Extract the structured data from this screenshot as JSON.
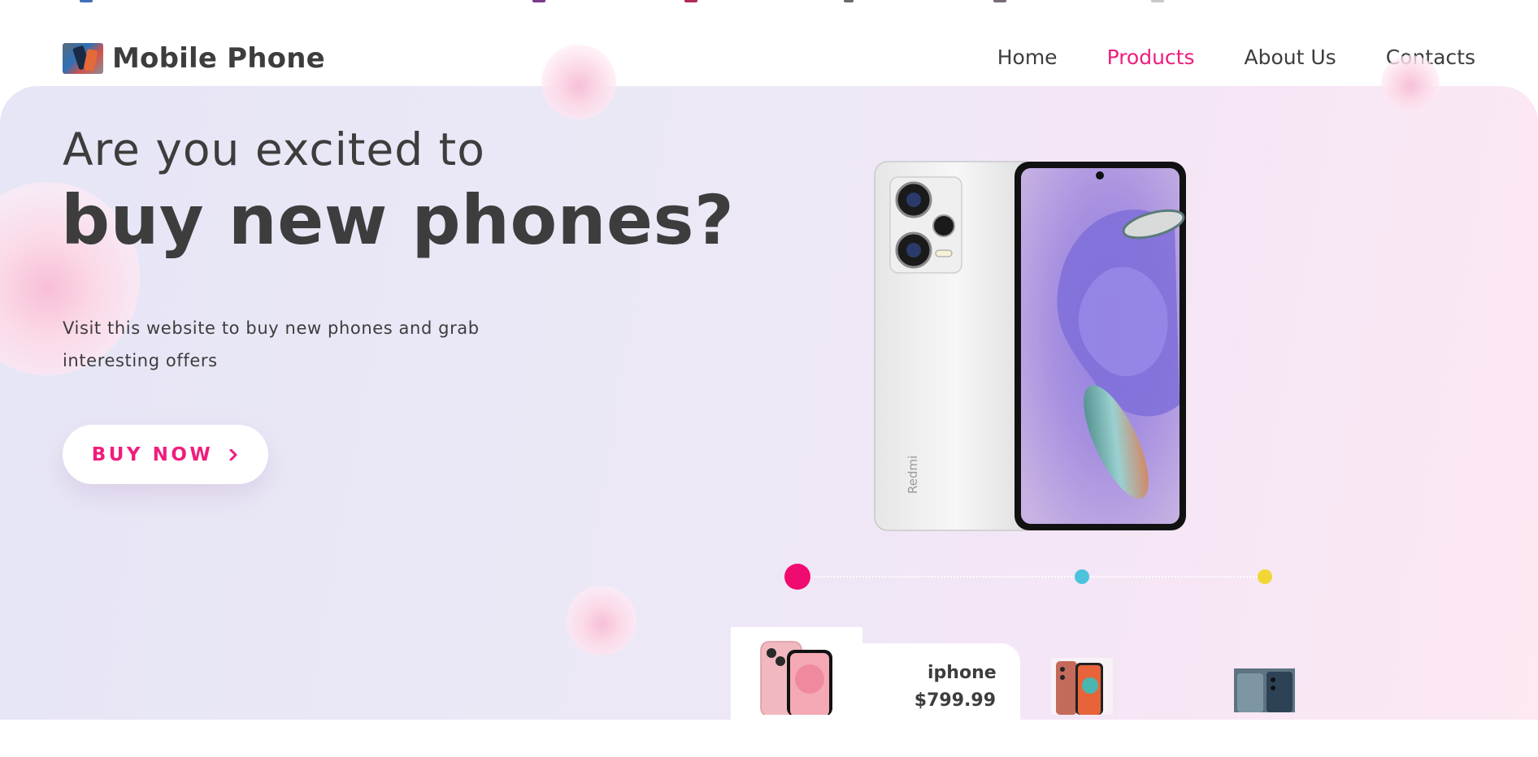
{
  "header": {
    "brand": "Mobile Phone",
    "nav": [
      {
        "label": "Home",
        "active": false
      },
      {
        "label": "Products",
        "active": true
      },
      {
        "label": "About Us",
        "active": false
      },
      {
        "label": "Contacts",
        "active": false
      }
    ]
  },
  "hero": {
    "line1": "Are you excited to",
    "line2": "buy new phones?",
    "subtext": "Visit this website to buy new phones and grab interesting offers",
    "cta": "BUY NOW",
    "phone_brand": "Redmi"
  },
  "slider": {
    "dots": [
      {
        "name": "slider-dot-1",
        "color": "#ef0b6f",
        "active": true
      },
      {
        "name": "slider-dot-2",
        "color": "#4cc3dc",
        "active": false
      },
      {
        "name": "slider-dot-3",
        "color": "#f0d735",
        "active": false
      }
    ]
  },
  "products": [
    {
      "name": "iphone",
      "price": "$799.99",
      "selected": true
    },
    {
      "name": "",
      "price": "",
      "selected": false
    },
    {
      "name": "",
      "price": "",
      "selected": false
    }
  ],
  "colors": {
    "accent": "#ef1d7d",
    "text": "#3d3d3d"
  },
  "icons": {
    "cta_arrow": "chevron-right-icon"
  }
}
